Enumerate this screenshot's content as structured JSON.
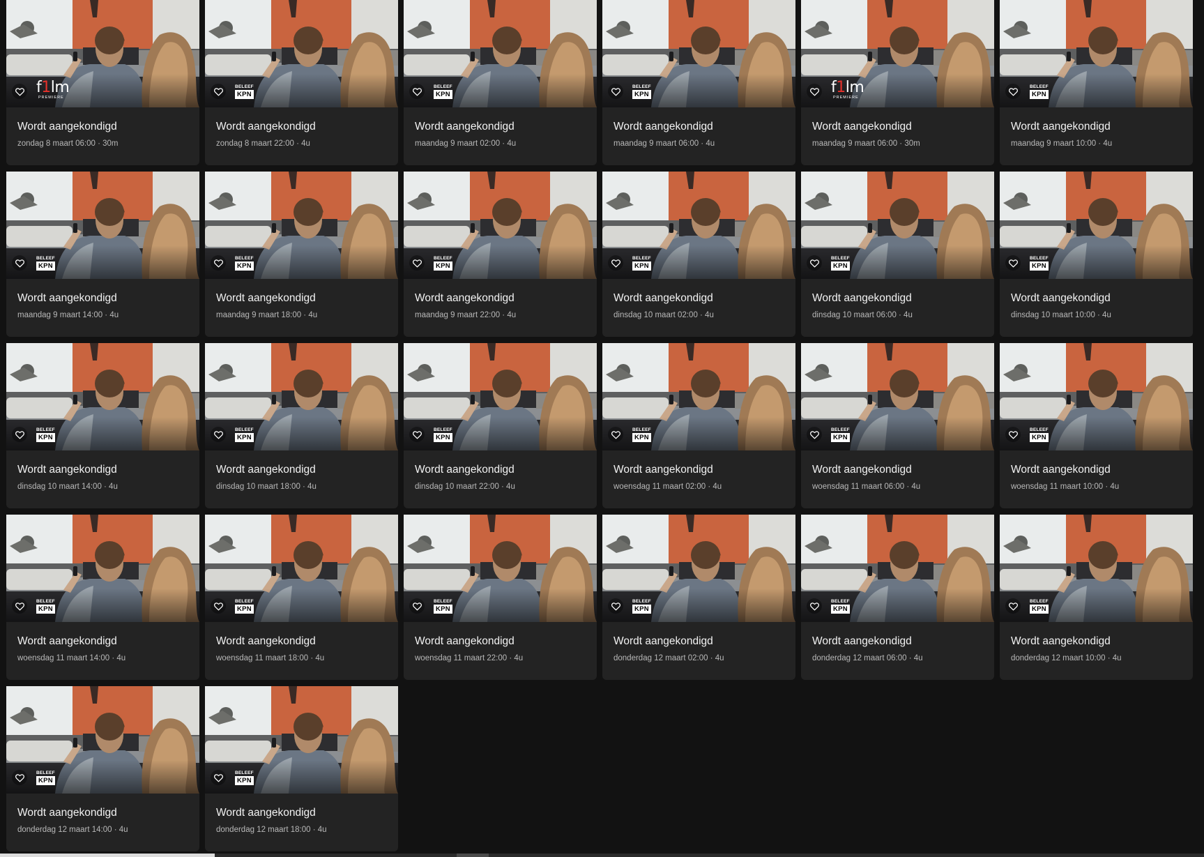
{
  "colors": {
    "background": "#121212",
    "card": "#232323",
    "title": "#f2f2f2",
    "meta": "#b8b8b8",
    "film_accent": "#e4312b"
  },
  "icons": {
    "favorite": "heart-outline-icon"
  },
  "logos": {
    "kpn": {
      "top": "BELEEF",
      "main": "KPN"
    },
    "film": {
      "pre": "f",
      "accent": "1",
      "post": "lm",
      "sub": "PREMIERE"
    }
  },
  "items": [
    {
      "title": "Wordt aangekondigd",
      "meta": "zondag 8 maart 06:00 · 30m",
      "channel": "film"
    },
    {
      "title": "Wordt aangekondigd",
      "meta": "zondag 8 maart 22:00 · 4u",
      "channel": "kpn"
    },
    {
      "title": "Wordt aangekondigd",
      "meta": "maandag 9 maart 02:00 · 4u",
      "channel": "kpn"
    },
    {
      "title": "Wordt aangekondigd",
      "meta": "maandag 9 maart 06:00 · 4u",
      "channel": "kpn"
    },
    {
      "title": "Wordt aangekondigd",
      "meta": "maandag 9 maart 06:00 · 30m",
      "channel": "film"
    },
    {
      "title": "Wordt aangekondigd",
      "meta": "maandag 9 maart 10:00 · 4u",
      "channel": "kpn"
    },
    {
      "title": "Wordt aangekondigd",
      "meta": "maandag 9 maart 14:00 · 4u",
      "channel": "kpn"
    },
    {
      "title": "Wordt aangekondigd",
      "meta": "maandag 9 maart 18:00 · 4u",
      "channel": "kpn"
    },
    {
      "title": "Wordt aangekondigd",
      "meta": "maandag 9 maart 22:00 · 4u",
      "channel": "kpn"
    },
    {
      "title": "Wordt aangekondigd",
      "meta": "dinsdag 10 maart 02:00 · 4u",
      "channel": "kpn"
    },
    {
      "title": "Wordt aangekondigd",
      "meta": "dinsdag 10 maart 06:00 · 4u",
      "channel": "kpn"
    },
    {
      "title": "Wordt aangekondigd",
      "meta": "dinsdag 10 maart 10:00 · 4u",
      "channel": "kpn"
    },
    {
      "title": "Wordt aangekondigd",
      "meta": "dinsdag 10 maart 14:00 · 4u",
      "channel": "kpn"
    },
    {
      "title": "Wordt aangekondigd",
      "meta": "dinsdag 10 maart 18:00 · 4u",
      "channel": "kpn"
    },
    {
      "title": "Wordt aangekondigd",
      "meta": "dinsdag 10 maart 22:00 · 4u",
      "channel": "kpn"
    },
    {
      "title": "Wordt aangekondigd",
      "meta": "woensdag 11 maart 02:00 · 4u",
      "channel": "kpn"
    },
    {
      "title": "Wordt aangekondigd",
      "meta": "woensdag 11 maart 06:00 · 4u",
      "channel": "kpn"
    },
    {
      "title": "Wordt aangekondigd",
      "meta": "woensdag 11 maart 10:00 · 4u",
      "channel": "kpn"
    },
    {
      "title": "Wordt aangekondigd",
      "meta": "woensdag 11 maart 14:00 · 4u",
      "channel": "kpn"
    },
    {
      "title": "Wordt aangekondigd",
      "meta": "woensdag 11 maart 18:00 · 4u",
      "channel": "kpn"
    },
    {
      "title": "Wordt aangekondigd",
      "meta": "woensdag 11 maart 22:00 · 4u",
      "channel": "kpn"
    },
    {
      "title": "Wordt aangekondigd",
      "meta": "donderdag 12 maart 02:00 · 4u",
      "channel": "kpn"
    },
    {
      "title": "Wordt aangekondigd",
      "meta": "donderdag 12 maart 06:00 · 4u",
      "channel": "kpn"
    },
    {
      "title": "Wordt aangekondigd",
      "meta": "donderdag 12 maart 10:00 · 4u",
      "channel": "kpn"
    },
    {
      "title": "Wordt aangekondigd",
      "meta": "donderdag 12 maart 14:00 · 4u",
      "channel": "kpn"
    },
    {
      "title": "Wordt aangekondigd",
      "meta": "donderdag 12 maart 18:00 · 4u",
      "channel": "kpn"
    }
  ]
}
